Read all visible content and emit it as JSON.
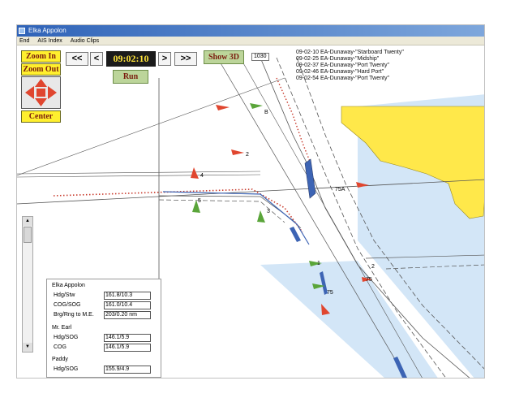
{
  "window": {
    "title": "Elka Appolon"
  },
  "menu": [
    "End",
    "AIS Index",
    "Audio Clips"
  ],
  "toolbar": {
    "zoom_in": "Zoom In",
    "zoom_out": "Zoom Out",
    "center": "Center",
    "rewind_fast": "<<",
    "step_back": "<",
    "time": "09:02:10",
    "step_forward": ">",
    "forward_fast": ">>",
    "run": "Run",
    "show_3d": "Show 3D"
  },
  "scale_label": "1030",
  "event_log": [
    "09-02-10 EA-Dunaway-\"Starboard Twenty\"",
    "09-02-25 EA-Dunaway-\"Midship\"",
    "09-02-37 EA-Dunaway-\"Port Twenty\"",
    "09-02-46 EA-Dunaway-\"Hard Port\"",
    "09-02-54 EA-Dunaway-\"Port Twenty\""
  ],
  "buoy_labels": [
    "B",
    "2",
    "4",
    "5",
    "3",
    "75A",
    "1",
    "2",
    "75",
    "75"
  ],
  "info_panel": {
    "vessels": [
      {
        "name": "Elka Appolon",
        "fields": [
          {
            "label": "Hdg/Stw",
            "value": "161.8/10.3"
          },
          {
            "label": "COG/SOG",
            "value": "161.0/10.4"
          },
          {
            "label": "Brg/Rng to M.E.",
            "value": "203/0.20 nm"
          }
        ]
      },
      {
        "name": "Mr. Earl",
        "fields": [
          {
            "label": "Hdg/SOG",
            "value": "146.1/5.9"
          },
          {
            "label": "COG",
            "value": "146.1/5.9"
          }
        ]
      },
      {
        "name": "Paddy",
        "fields": [
          {
            "label": "Hdg/SOG",
            "value": "155.9/4.9"
          }
        ]
      }
    ]
  },
  "colors": {
    "land": "#ffe84a",
    "water": "#d3e6f7",
    "vessel_blue": "#3d64b4",
    "buoy_red": "#e0462f",
    "buoy_green": "#5aa53a"
  },
  "icons": {
    "pan": "four-way-arrow-icon",
    "scroll_up": "arrow-up-icon",
    "scroll_down": "arrow-down-icon"
  }
}
